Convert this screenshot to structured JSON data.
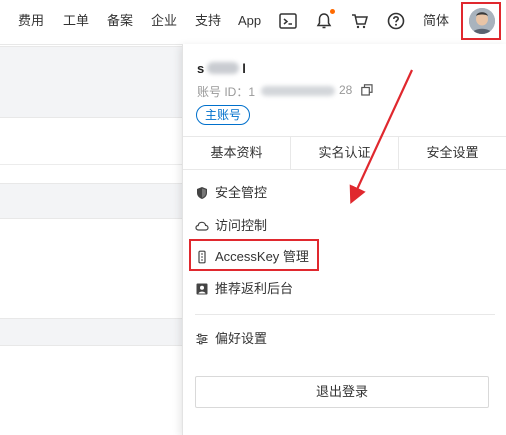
{
  "nav": {
    "items": [
      "费用",
      "工单",
      "备案",
      "企业",
      "支持",
      "App"
    ],
    "lang": "简体"
  },
  "account": {
    "name_prefix": "s",
    "name_suffix": "l",
    "id_label": "账号 ID：1",
    "id_suffix": "28",
    "badge": "主账号"
  },
  "tabs": [
    "基本资料",
    "实名认证",
    "安全设置"
  ],
  "menu": [
    {
      "label": "安全管控",
      "icon": "shield-icon"
    },
    {
      "label": "访问控制",
      "icon": "cloud-icon"
    },
    {
      "label": "AccessKey 管理",
      "icon": "key-icon"
    },
    {
      "label": "推荐返利后台",
      "icon": "profile-icon"
    },
    {
      "label": "偏好设置",
      "icon": "sliders-icon"
    }
  ],
  "logout_label": "退出登录",
  "colors": {
    "accent": "#0070cc",
    "highlight": "#e0282e",
    "notification": "#ff6a00"
  }
}
